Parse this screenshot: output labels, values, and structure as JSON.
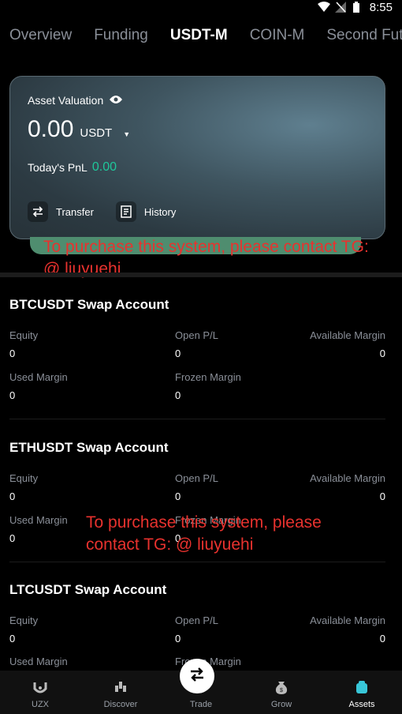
{
  "status": {
    "time": "8:55"
  },
  "tabs": [
    {
      "label": "Overview"
    },
    {
      "label": "Funding"
    },
    {
      "label": "USDT-M"
    },
    {
      "label": "COIN-M"
    },
    {
      "label": "Second Futu"
    }
  ],
  "valuation": {
    "label": "Asset Valuation",
    "amount": "0.00",
    "unit": "USDT",
    "pnl_label": "Today's PnL",
    "pnl_value": "0.00",
    "transfer_label": "Transfer",
    "history_label": "History"
  },
  "watermark": {
    "line1a": "To purchase this system, please contact TG:",
    "line1b": "@ liuyuehi",
    "line2a": "To purchase this system, please",
    "line2b": "contact TG: @ liuyuehi"
  },
  "labels": {
    "equity": "Equity",
    "open_pl": "Open P/L",
    "available_margin": "Available Margin",
    "used_margin": "Used Margin",
    "frozen_margin": "Frozen Margin",
    "frozen_margin_partial": "Fro"
  },
  "accounts": [
    {
      "title": "BTCUSDT Swap Account",
      "equity": "0",
      "open_pl": "0",
      "available_margin": "0",
      "used_margin": "0",
      "frozen_margin": "0"
    },
    {
      "title": "ETHUSDT Swap Account",
      "equity": "0",
      "open_pl": "0",
      "available_margin": "0",
      "used_margin": "0",
      "frozen_margin": "0"
    },
    {
      "title": "LTCUSDT Swap Account",
      "equity": "0",
      "open_pl": "0",
      "available_margin": "0"
    }
  ],
  "nav": [
    {
      "label": "UZX",
      "icon": "uzx-logo-icon"
    },
    {
      "label": "Discover",
      "icon": "discover-icon"
    },
    {
      "label": "Trade",
      "icon": "swap-arrows-icon"
    },
    {
      "label": "Grow",
      "icon": "money-bag-icon"
    },
    {
      "label": "Assets",
      "icon": "wallet-icon"
    }
  ],
  "colors": {
    "accent_green": "#1fc79a",
    "watermark_red": "#e8322e"
  }
}
